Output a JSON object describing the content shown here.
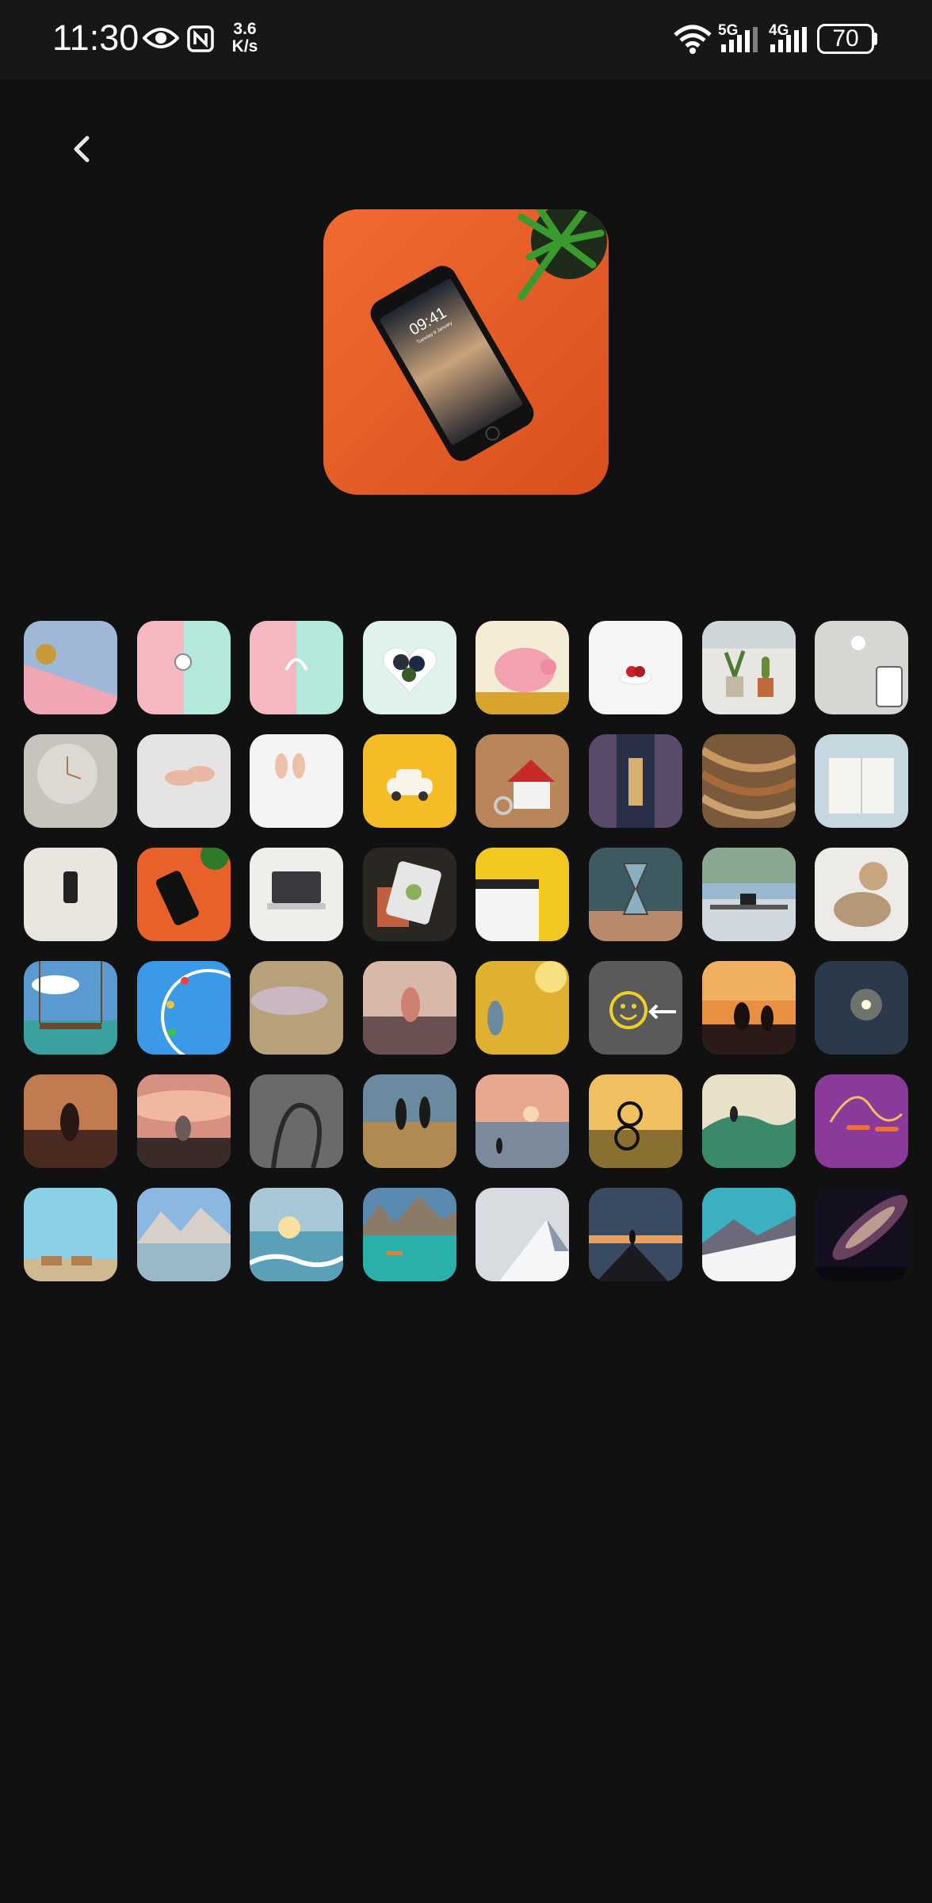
{
  "status_bar": {
    "time": "11:30",
    "net_speed_value": "3.6",
    "net_speed_unit": "K/s",
    "sim1_label": "5G",
    "sim2_label": "4G",
    "battery": "70",
    "icons": [
      "eye-icon",
      "nfc-icon",
      "wifi-icon",
      "signal-icon",
      "battery-icon"
    ]
  },
  "navigation": {
    "back_icon": "chevron-left-icon"
  },
  "preview": {
    "subject": "phone-on-orange-wallpaper",
    "phone_time": "09:41",
    "phone_date": "Tuesday 9 January"
  },
  "wallpapers": [
    "pastel-blue-pink-gold-coin",
    "pastel-pink-mint-clock",
    "pastel-pink-mint-headphones",
    "berry-heart-bowl",
    "pink-piggy-bank",
    "strawberry-bowl-white",
    "potted-plants-window",
    "desk-flatlay-gray",
    "white-wall-clock",
    "baby-feet-blanket",
    "baby-feet-white-sheets",
    "toy-car-yellow",
    "house-model-keys",
    "library-corridor",
    "curved-bookshelves",
    "open-book-beach",
    "phone-on-white",
    "phone-on-orange",
    "laptop-on-desk",
    "tablet-drawing-dark",
    "clapperboard-yellow",
    "hourglass-sand",
    "desk-lake-view",
    "dog-and-cat",
    "beach-swing",
    "ferris-wheel-sky",
    "smile-stone",
    "finger-heart-sunset",
    "child-golden-field",
    "smiley-arrow-ground",
    "couple-sunset-hill",
    "sparkler-night",
    "yoga-sunset",
    "meditation-clouds",
    "jump-rope-shadow",
    "friends-beach-walk",
    "beach-sunset-runner",
    "bicycle-sunset",
    "surfer-wave",
    "jump-rope-purple",
    "beach-chairs-sky",
    "mountain-lake-reflection",
    "ocean-sunrise-waves",
    "turquoise-lake-boat",
    "snowy-mountain-clouds",
    "summit-sunset-hiker",
    "snowy-slope-mountains",
    "milky-way-night"
  ]
}
